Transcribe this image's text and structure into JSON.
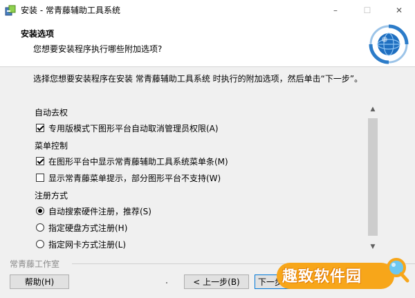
{
  "window": {
    "title": "安装 - 常青藤辅助工具系统",
    "controls": {
      "minimize": "–",
      "maximize": "☐",
      "close": "✕"
    }
  },
  "header": {
    "title": "安装选项",
    "subtitle": "您想要安装程序执行哪些附加选项?"
  },
  "main": {
    "description": "选择您想要安装程序在安装 常青藤辅助工具系统 时执行的附加选项，然后单击“下一步”。",
    "groups": [
      {
        "title": "自动去权",
        "options": [
          {
            "type": "checkbox",
            "label": "专用版模式下图形平台自动取消管理员权限(A)",
            "checked": true
          }
        ]
      },
      {
        "title": "菜单控制",
        "options": [
          {
            "type": "checkbox",
            "label": "在图形平台中显示常青藤辅助工具系统菜单条(M)",
            "checked": true
          },
          {
            "type": "checkbox",
            "label": "显示常青藤菜单提示，部分图形平台不支持(W)",
            "checked": false
          }
        ]
      },
      {
        "title": "注册方式",
        "options": [
          {
            "type": "radio",
            "label": "自动搜索硬件注册，推荐(S)",
            "checked": true
          },
          {
            "type": "radio",
            "label": "指定硬盘方式注册(H)",
            "checked": false
          },
          {
            "type": "radio",
            "label": "指定网卡方式注册(L)",
            "checked": false
          }
        ]
      }
    ]
  },
  "footer": {
    "brand": "常青藤工作室",
    "help_label": "帮助(H)",
    "back_label": "< 上一步(B)",
    "next_label": "下一步(N)"
  },
  "watermark": {
    "text": "趣致软件园"
  },
  "colors": {
    "accent": "#0078d7",
    "watermark": "#f7a61a"
  }
}
